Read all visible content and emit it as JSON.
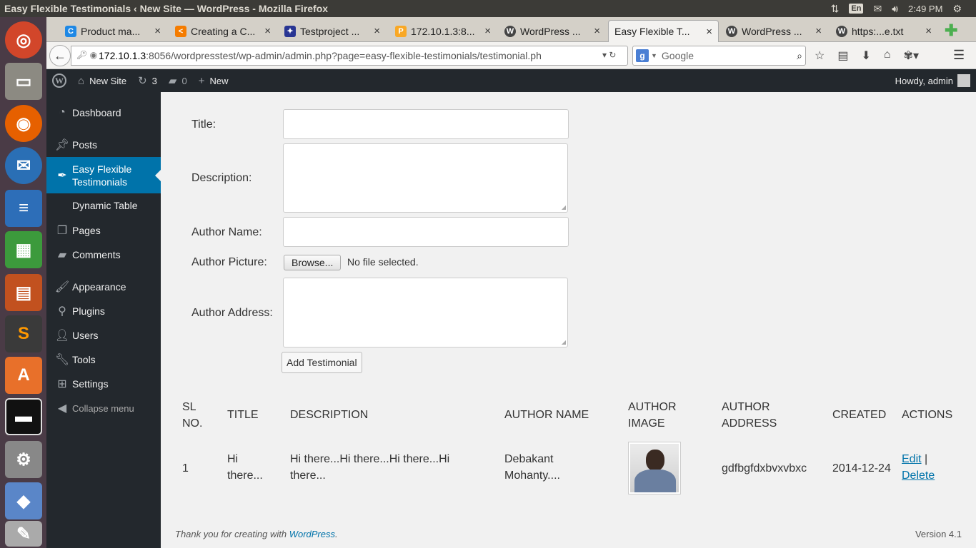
{
  "window": {
    "title": "Easy Flexible Testimonials ‹ New Site — WordPress - Mozilla Firefox"
  },
  "system_tray": {
    "language": "En",
    "time": "2:49 PM"
  },
  "launcher": {
    "apps": [
      "dash-icon",
      "files-icon",
      "firefox-icon",
      "thunderbird-icon",
      "writer-icon",
      "calc-icon",
      "impress-icon",
      "sublime-icon",
      "software-center-icon",
      "terminal-icon",
      "settings-icon",
      "virtualbox-icon",
      "trash-icon"
    ]
  },
  "tabs": [
    {
      "label": "Product ma...",
      "close": "×"
    },
    {
      "label": "Creating a C...",
      "close": "×"
    },
    {
      "label": "Testproject ...",
      "close": "×"
    },
    {
      "label": "172.10.1.3:8...",
      "close": "×"
    },
    {
      "label": "WordPress ...",
      "close": "×"
    },
    {
      "label": "Easy Flexible T...",
      "close": "×"
    },
    {
      "label": "WordPress ...",
      "close": "×"
    },
    {
      "label": "https:...e.txt",
      "close": "×"
    }
  ],
  "new_tab": "✚",
  "navbar": {
    "url_host": "172.10.1.3",
    "url_rest": ":8056/wordpresstest/wp-admin/admin.php?page=easy-flexible-testimonials/testimonial.ph",
    "search_placeholder": "Google"
  },
  "adminbar": {
    "site_name": "New Site",
    "updates": "3",
    "comments": "0",
    "new_label": "New",
    "howdy": "Howdy, admin"
  },
  "sidebar": {
    "items": [
      {
        "label": "Dashboard",
        "icon": "dashboard-icon"
      },
      {
        "label": "Posts",
        "icon": "pin-icon"
      },
      {
        "label": "Easy Flexible Testimonials",
        "icon": "feather-icon",
        "current": true
      },
      {
        "label": "Dynamic Table",
        "sub": true
      },
      {
        "label": "Pages",
        "icon": "pages-icon"
      },
      {
        "label": "Comments",
        "icon": "comments-icon"
      },
      {
        "label": "Appearance",
        "icon": "brush-icon"
      },
      {
        "label": "Plugins",
        "icon": "plug-icon"
      },
      {
        "label": "Users",
        "icon": "users-icon"
      },
      {
        "label": "Tools",
        "icon": "wrench-icon"
      },
      {
        "label": "Settings",
        "icon": "settings-icon"
      },
      {
        "label": "Collapse menu",
        "icon": "collapse-icon"
      }
    ]
  },
  "form": {
    "title_label": "Title:",
    "title_value": "",
    "description_label": "Description:",
    "description_value": "",
    "author_name_label": "Author Name:",
    "author_name_value": "",
    "author_picture_label": "Author Picture:",
    "browse_button": "Browse...",
    "no_file": "No file selected.",
    "author_address_label": "Author Address:",
    "author_address_value": "",
    "submit_button": "Add Testimonial"
  },
  "table": {
    "headers": {
      "sl_1": "SL",
      "sl_2": "NO.",
      "title": "TITLE",
      "description": "DESCRIPTION",
      "author_name": "AUTHOR NAME",
      "author_image_1": "AUTHOR",
      "author_image_2": "IMAGE",
      "author_address_1": "AUTHOR",
      "author_address_2": "ADDRESS",
      "created": "CREATED",
      "actions": "ACTIONS"
    },
    "rows": [
      {
        "sl": "1",
        "title_1": "Hi",
        "title_2": "there...",
        "description_1": "Hi there...Hi there...Hi there...Hi",
        "description_2": "there...",
        "author_name_1": "Debakant",
        "author_name_2": "Mohanty....",
        "author_address": "gdfbgfdxbvxvbxc",
        "created": "2014-12-24",
        "edit": "Edit",
        "separator": "|",
        "delete": "Delete"
      }
    ]
  },
  "footer": {
    "thanks_prefix": "Thank you for creating with ",
    "thanks_link": "WordPress",
    "thanks_suffix": ".",
    "version": "Version 4.1"
  }
}
